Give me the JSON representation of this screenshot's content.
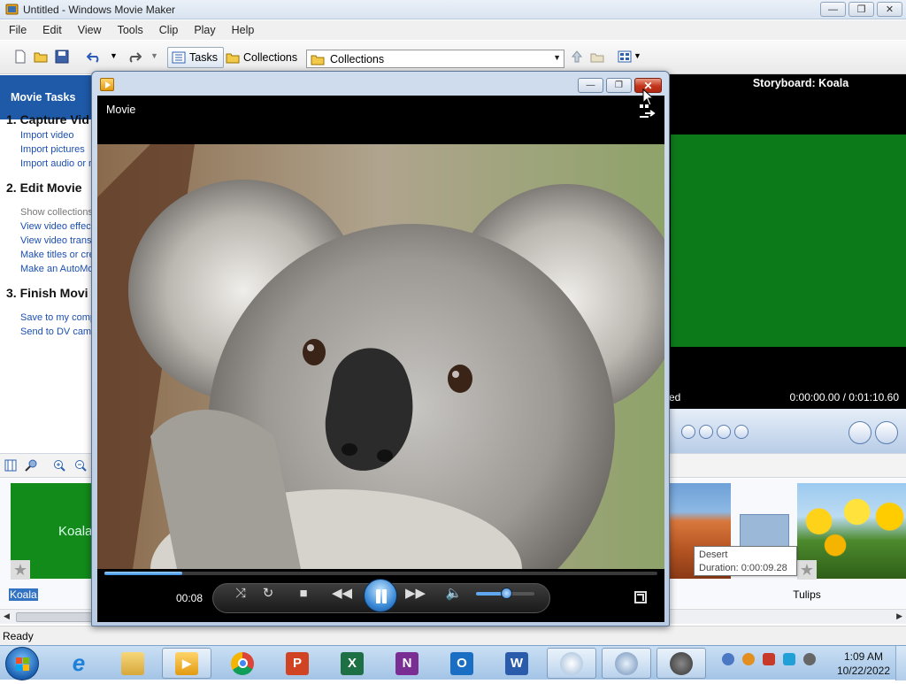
{
  "window": {
    "title": "Untitled - Windows Movie Maker",
    "minimize": "—",
    "maximize": "❐",
    "close": "✕"
  },
  "menu": [
    "File",
    "Edit",
    "View",
    "Tools",
    "Clip",
    "Play",
    "Help"
  ],
  "toolbar": {
    "tasks_label": "Tasks",
    "collections_label": "Collections",
    "collections_select": "Collections"
  },
  "task_pane": {
    "header": "Movie Tasks",
    "sections": [
      {
        "title": "1. Capture Vid",
        "links": [
          "Import video",
          "Import pictures",
          "Import audio or m"
        ]
      },
      {
        "title": "2. Edit Movie",
        "links": [
          "Show collections",
          "View video effec",
          "View video trans",
          "Make titles or cre",
          "Make an AutoMo"
        ]
      },
      {
        "title": "3. Finish Movi",
        "links": [
          "Save to my comp",
          "Send to DV came"
        ]
      }
    ]
  },
  "monitor": {
    "title": "Storyboard: Koala",
    "status": "ed",
    "time": "0:00:00.00 / 0:01:10.60",
    "screen_color": "#0d7a1a"
  },
  "storyboard": {
    "clips": [
      {
        "name": "Koala",
        "selected": true
      },
      {
        "name": "Tulips",
        "selected": false
      }
    ],
    "tooltip": {
      "title": "Desert",
      "duration": "Duration:  0:00:09.28"
    }
  },
  "statusbar": {
    "text": "Ready"
  },
  "player": {
    "title": "Movie",
    "elapsed": "00:08",
    "progress": 0.14,
    "volume": 0.52,
    "accent": "#3b8ad8"
  },
  "taskbar": {
    "apps": [
      {
        "name": "ie-icon"
      },
      {
        "name": "explorer-icon"
      },
      {
        "name": "media-player-icon"
      },
      {
        "name": "chrome-icon"
      },
      {
        "name": "powerpoint-icon"
      },
      {
        "name": "excel-icon"
      },
      {
        "name": "onenote-icon"
      },
      {
        "name": "outlook-icon"
      },
      {
        "name": "word-icon"
      }
    ],
    "time": "1:09 AM",
    "date": "10/22/2022"
  }
}
